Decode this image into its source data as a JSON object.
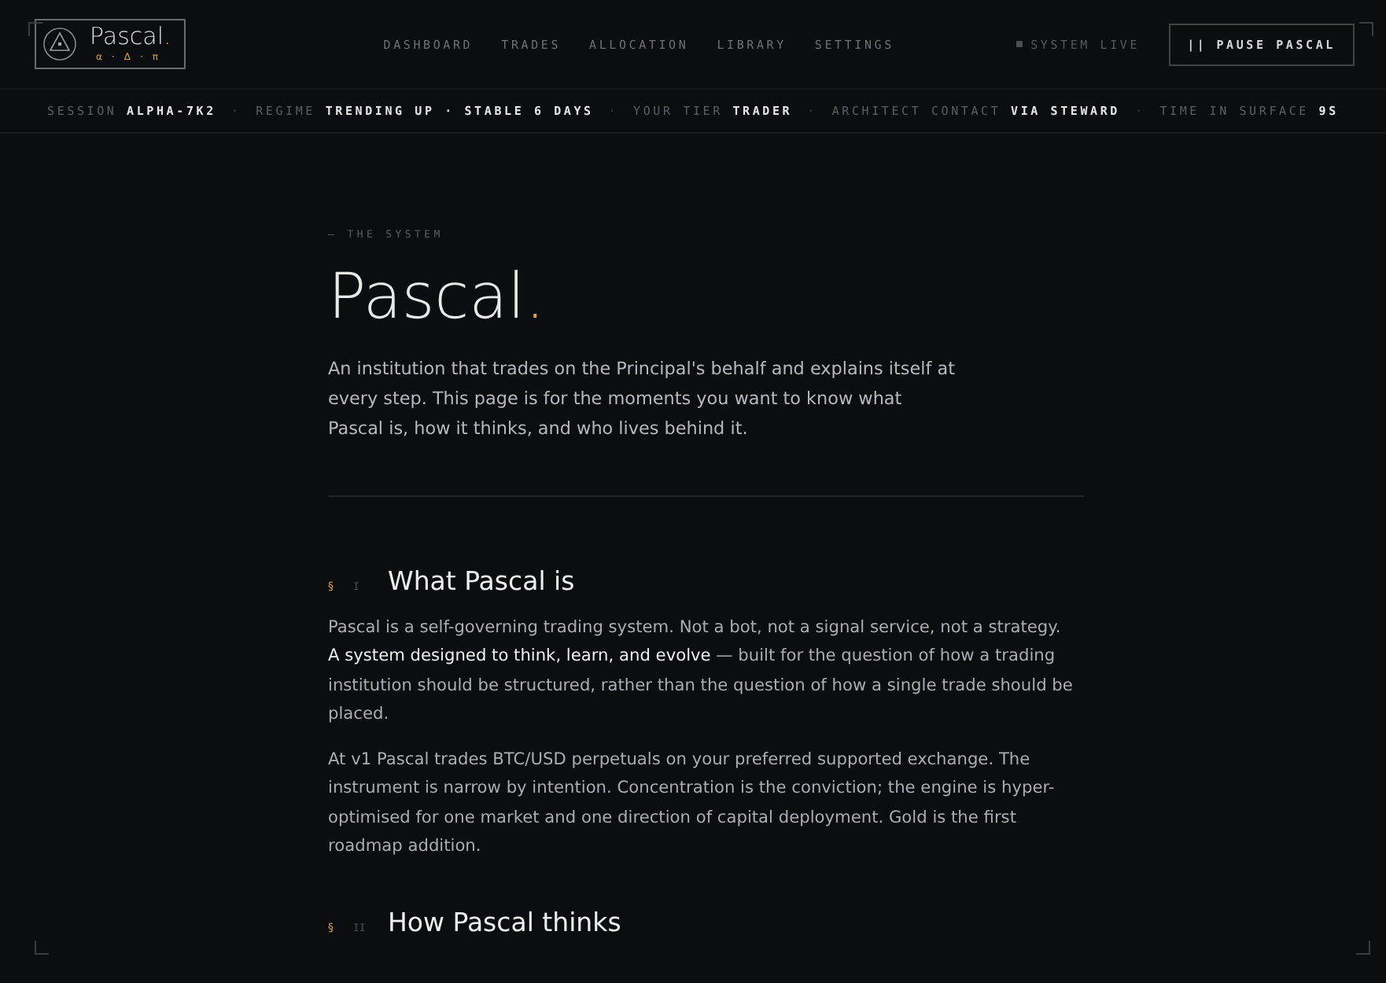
{
  "logo": {
    "name": "Pascal",
    "dot": ".",
    "glyphs": [
      "α",
      "·",
      "Δ",
      "·",
      "π"
    ]
  },
  "nav": [
    {
      "label": "DASHBOARD",
      "selected": false
    },
    {
      "label": "TRADES",
      "selected": false
    },
    {
      "label": "ALLOCATION",
      "selected": false
    },
    {
      "label": "LIBRARY",
      "selected": false
    },
    {
      "label": "SETTINGS",
      "selected": false
    }
  ],
  "system_status": {
    "label": "SYSTEM LIVE"
  },
  "pause_button": {
    "icon": "||",
    "label": "PAUSE PASCAL"
  },
  "status_bar": [
    {
      "label": "SESSION",
      "value": "ALPHA-7K2"
    },
    {
      "label": "REGIME",
      "value": "TRENDING UP · STABLE 6 DAYS"
    },
    {
      "label": "YOUR TIER",
      "value": "TRADER"
    },
    {
      "label": "ARCHITECT CONTACT",
      "value": "VIA STEWARD"
    },
    {
      "label": "TIME IN SURFACE",
      "value": "9S"
    }
  ],
  "separator": "·",
  "hero": {
    "eyebrow": "— THE SYSTEM",
    "title": "Pascal",
    "title_dot": ".",
    "intro": "An institution that trades on the Principal's behalf and explains itself at every step. This page is for the moments you want to know what Pascal is, how it thinks, and who lives behind it."
  },
  "sections": [
    {
      "mark": "§",
      "numeral": "I",
      "title": "What Pascal is",
      "paragraphs": [
        "Pascal is a self-governing trading system. Not a bot, not a signal service, not a strategy. **A system designed to think, learn, and evolve** — built for the question of how a trading institution should be structured, rather than the question of how a single trade should be placed.",
        "At v1 Pascal trades BTC/USD perpetuals on your preferred supported exchange. The instrument is narrow by intention. Concentration is the conviction; the engine is hyper-optimised for one market and one direction of capital deployment. Gold is the first roadmap addition."
      ]
    },
    {
      "mark": "§",
      "numeral": "II",
      "title": "How Pascal thinks"
    }
  ]
}
